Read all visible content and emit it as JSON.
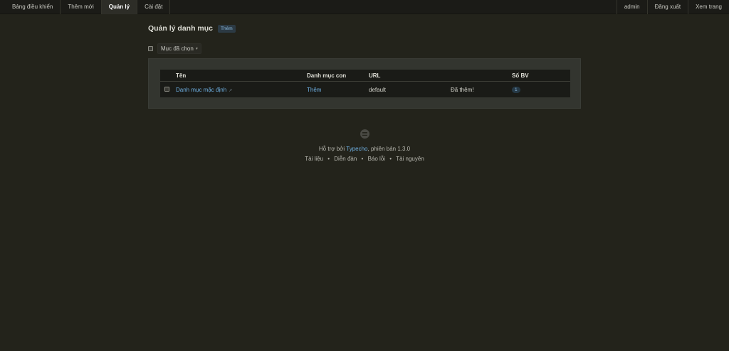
{
  "nav": {
    "left": [
      {
        "label": "Bảng điều khiển",
        "active": false
      },
      {
        "label": "Thêm mới",
        "active": false
      },
      {
        "label": "Quản lý",
        "active": true
      },
      {
        "label": "Cài đặt",
        "active": false
      }
    ],
    "right": [
      {
        "label": "admin"
      },
      {
        "label": "Đăng xuất"
      },
      {
        "label": "Xem trang"
      }
    ]
  },
  "page": {
    "title": "Quản lý danh mục",
    "add_badge": "Thêm"
  },
  "actions": {
    "dropdown_label": "Mục đã chọn",
    "caret": "▾"
  },
  "table": {
    "headers": {
      "name": "Tên",
      "subcategory": "Danh mục con",
      "url": "URL",
      "note": "",
      "count": "Số BV"
    },
    "rows": [
      {
        "name": "Danh mục mặc định",
        "subcategory": "Thêm",
        "url": "default",
        "note": "Đã thêm!",
        "count": "1"
      }
    ]
  },
  "footer": {
    "powered_prefix": "Hỗ trợ bởi ",
    "powered_link": "Typecho",
    "powered_suffix": ", phiên bản 1.3.0",
    "links": [
      "Tài liệu",
      "Diễn đàn",
      "Báo lỗi",
      "Tài nguyên"
    ],
    "separator": "•"
  },
  "colors": {
    "background": "#23231b",
    "topnav": "#1b1b17",
    "panel": "#33352f",
    "link": "#6fb0e3"
  }
}
